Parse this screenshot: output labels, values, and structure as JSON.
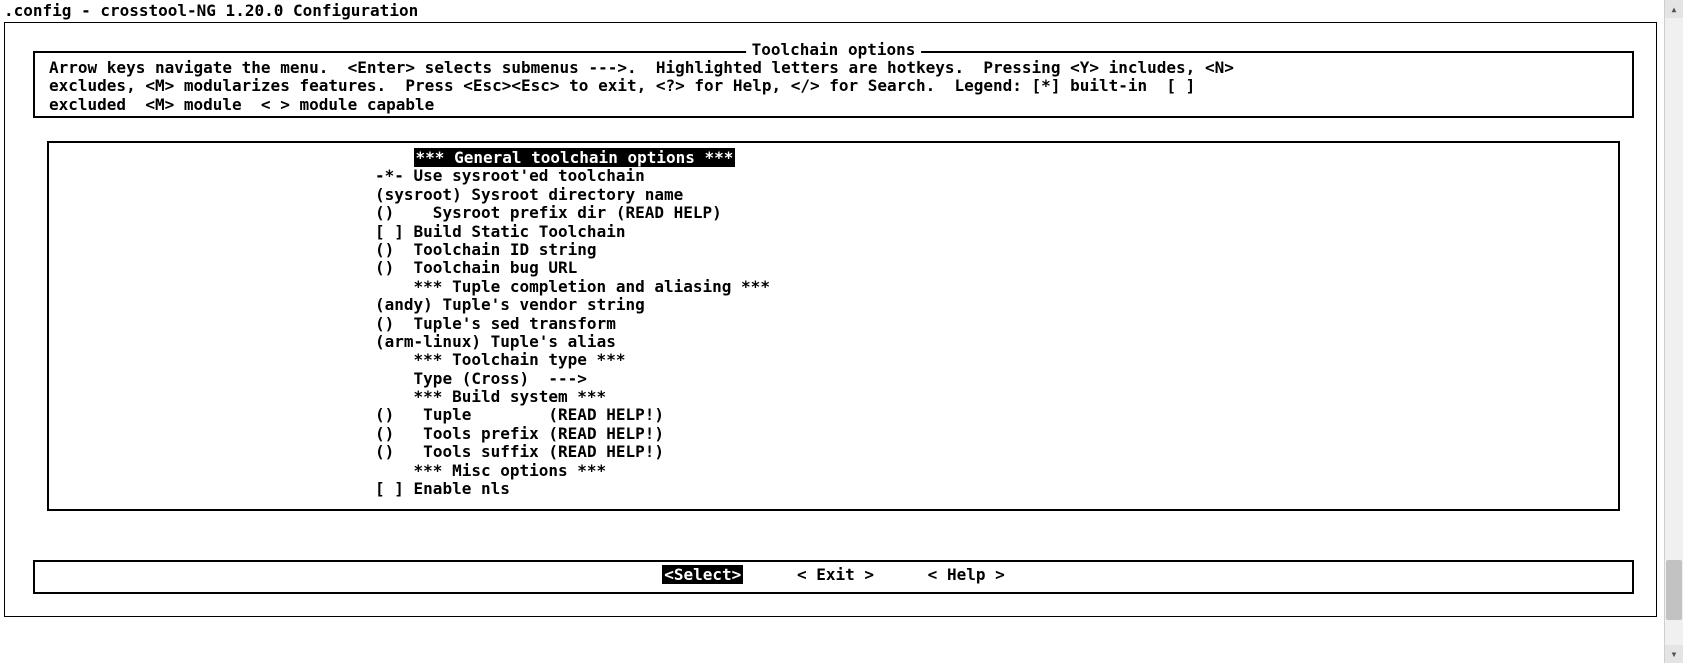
{
  "window_title": ".config - crosstool-NG 1.20.0 Configuration",
  "panel": {
    "title": "Toolchain options",
    "help": "Arrow keys navigate the menu.  <Enter> selects submenus --->.  Highlighted letters are hotkeys.  Pressing <Y> includes, <N>\nexcludes, <M> modularizes features.  Press <Esc><Esc> to exit, <?> for Help, </> for Search.  Legend: [*] built-in  [ ]\nexcluded  <M> module  < > module capable"
  },
  "menu": [
    {
      "type": "header_sel",
      "pad": "    ",
      "text": "*** General toolchain options ***"
    },
    {
      "type": "item",
      "prefix": "-*- ",
      "hotkey": "U",
      "label": "se sysroot'ed toolchain"
    },
    {
      "type": "item",
      "prefix": "(sysroot) ",
      "hotkey": "S",
      "label": "ysroot directory name"
    },
    {
      "type": "item",
      "prefix": "()    ",
      "hotkey": "S",
      "label": "ysroot prefix dir (READ HELP)"
    },
    {
      "type": "item",
      "prefix": "[ ] ",
      "hotkey": "B",
      "label": "uild Static Toolchain"
    },
    {
      "type": "item",
      "prefix": "()  ",
      "hotkey": "T",
      "label": "oolchain ID string"
    },
    {
      "type": "item",
      "prefix": "()  ",
      "hotkey": "T",
      "label": "oolchain bug URL"
    },
    {
      "type": "header",
      "pad": "    ",
      "text": "*** Tuple completion and aliasing ***"
    },
    {
      "type": "item",
      "prefix": "(andy) ",
      "hotkey": "T",
      "label": "uple's vendor string"
    },
    {
      "type": "item",
      "prefix": "()  ",
      "hotkey": "T",
      "label": "uple's sed transform"
    },
    {
      "type": "item",
      "prefix": "(arm-linux) ",
      "hotkey": "T",
      "label": "uple's alias"
    },
    {
      "type": "header",
      "pad": "    ",
      "text": "*** Toolchain type ***"
    },
    {
      "type": "item",
      "prefix": "    ",
      "hotkey": "T",
      "label": "ype (Cross)  --->"
    },
    {
      "type": "header",
      "pad": "    ",
      "text": "*** Build system ***"
    },
    {
      "type": "item",
      "prefix": "()   ",
      "hotkey": "T",
      "label": "uple        (READ HELP!)"
    },
    {
      "type": "item",
      "prefix": "()   ",
      "hotkey": "T",
      "label": "ools prefix (READ HELP!)"
    },
    {
      "type": "item",
      "prefix": "()   ",
      "hotkey": "T",
      "label": "ools suffix (READ HELP!)"
    },
    {
      "type": "header",
      "pad": "    ",
      "text": "*** Misc options ***"
    },
    {
      "type": "item",
      "prefix": "[ ] ",
      "hotkey": "E",
      "label": "nable nls"
    }
  ],
  "buttons": {
    "select": {
      "open": "<",
      "label": "Select",
      "close": ">"
    },
    "exit": {
      "open": "< ",
      "hotkey": "E",
      "label": "xit",
      "close": " >"
    },
    "help": {
      "open": "< ",
      "hotkey": "H",
      "label": "elp",
      "close": " >"
    }
  }
}
